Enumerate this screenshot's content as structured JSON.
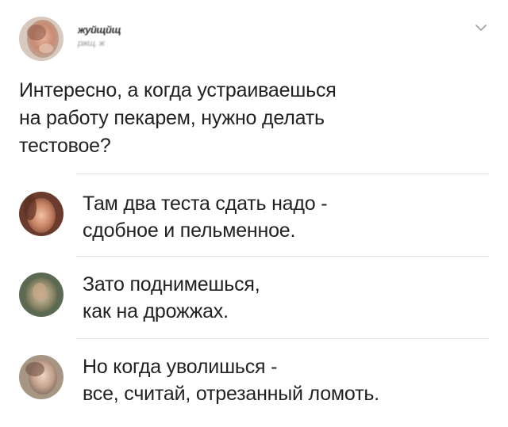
{
  "post": {
    "author_name": "жуйщйщ",
    "author_meta": "ржщ. ж",
    "text": "Интересно, а когда устраиваешься\nна работу пекарем, нужно делать\nтестовое?"
  },
  "comments": [
    {
      "text": "Там два теста сдать надо -\nсдобное и пельменное."
    },
    {
      "text": "Зато поднимешься,\nкак на дрожжах."
    },
    {
      "text": "Но когда уволишься -\nвсе, считай, отрезанный ломоть."
    }
  ],
  "icons": {
    "options": "chevron-down-icon",
    "avatars": "avatar"
  },
  "colors": {
    "text": "#222222",
    "meta": "#9a9a9a",
    "divider": "#e6e6e6",
    "chevron": "#9aa0a6"
  }
}
